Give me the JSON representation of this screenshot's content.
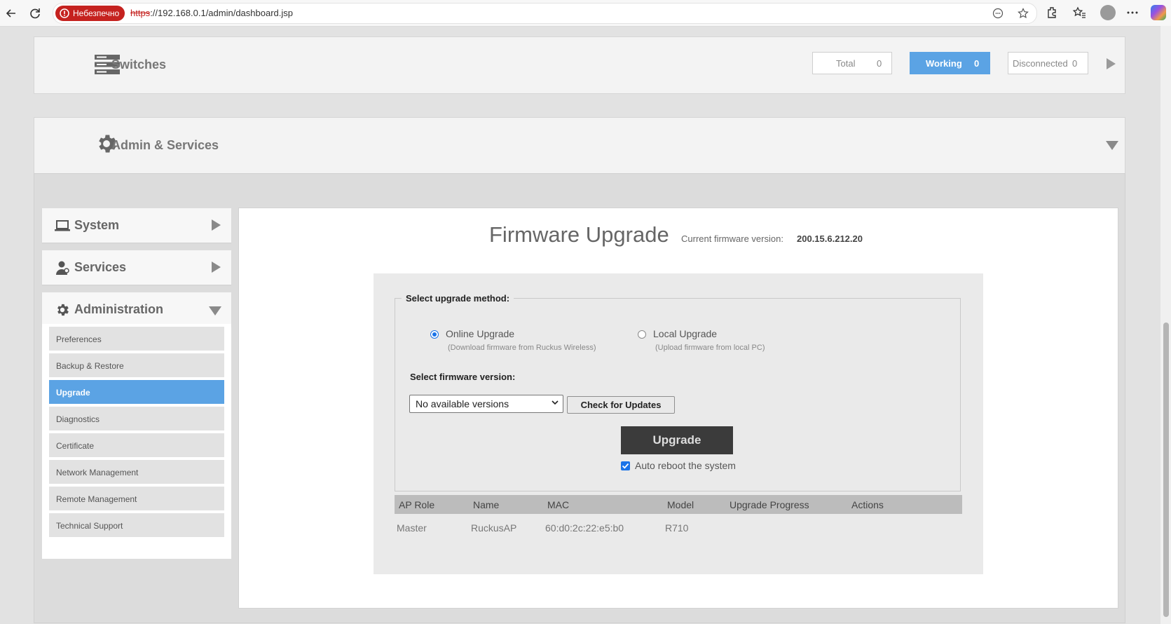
{
  "browser": {
    "security_badge": "Небезпечно",
    "url_scheme": "https",
    "url_rest": "://192.168.0.1/admin/dashboard.jsp"
  },
  "switches": {
    "title": "Switches",
    "total_label": "Total",
    "total_value": "0",
    "working_label": "Working",
    "working_value": "0",
    "disconnected_label": "Disconnected",
    "disconnected_value": "0"
  },
  "admin_panel": {
    "title": "Admin & Services"
  },
  "sidebar": {
    "system": "System",
    "services": "Services",
    "administration": "Administration",
    "items": [
      {
        "label": "Preferences"
      },
      {
        "label": "Backup & Restore"
      },
      {
        "label": "Upgrade",
        "active": true
      },
      {
        "label": "Diagnostics"
      },
      {
        "label": "Certificate"
      },
      {
        "label": "Network Management"
      },
      {
        "label": "Remote Management"
      },
      {
        "label": "Technical Support"
      }
    ]
  },
  "firmware": {
    "title": "Firmware Upgrade",
    "current_label": "Current firmware version:",
    "current_version": "200.15.6.212.20",
    "method_legend": "Select upgrade method:",
    "online_label": "Online Upgrade",
    "online_sub": "(Download firmware from Ruckus Wireless)",
    "online_selected": true,
    "local_label": "Local Upgrade",
    "local_sub": "(Upload firmware from local PC)",
    "version_label": "Select firmware version:",
    "version_selected": "No available versions",
    "check_button": "Check for Updates",
    "upgrade_button": "Upgrade",
    "auto_reboot_label": "Auto reboot the system",
    "auto_reboot_checked": true
  },
  "ap_table": {
    "headers": [
      "AP Role",
      "Name",
      "MAC",
      "Model",
      "Upgrade Progress",
      "Actions"
    ],
    "rows": [
      [
        "Master",
        "RuckusAP",
        "60:d0:2c:22:e5:b0",
        "R710",
        "",
        ""
      ]
    ]
  },
  "colors": {
    "accent": "#5ba3e4",
    "unsafe_badge": "#c5221f",
    "upgrade_button": "#3b3b3b"
  }
}
